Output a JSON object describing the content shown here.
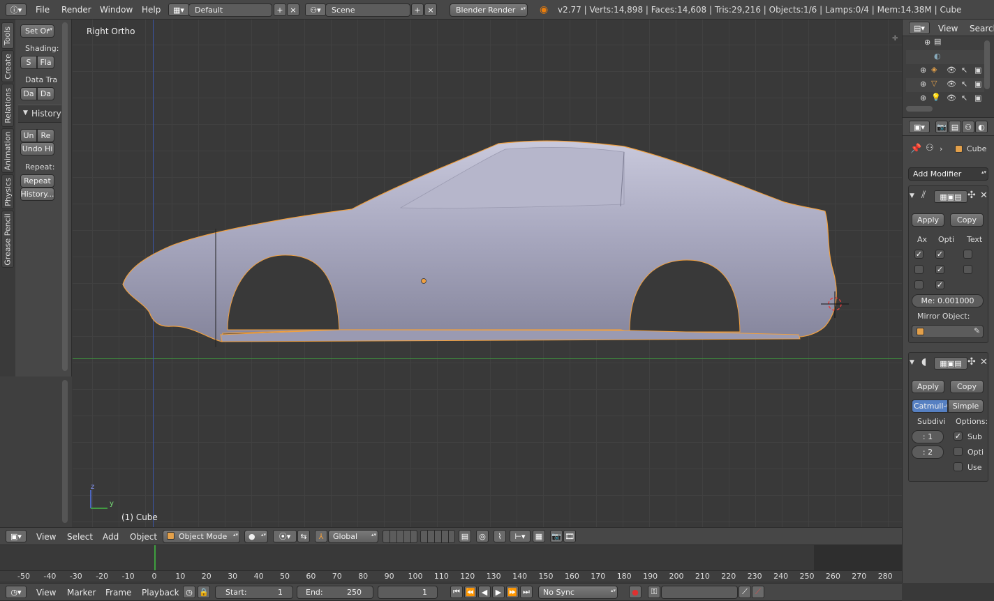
{
  "top_bar": {
    "menus": [
      "File",
      "Render",
      "Window",
      "Help"
    ],
    "layout": "Default",
    "scene": "Scene",
    "engine": "Blender Render",
    "stats": "v2.77 | Verts:14,898 | Faces:14,608 | Tris:29,216 | Objects:1/6 | Lamps:0/4 | Mem:14.38M | Cube"
  },
  "tool_shelf": {
    "tabs": [
      "Tools",
      "Create",
      "Relations",
      "Animation",
      "Physics",
      "Grease Pencil"
    ],
    "set_origin": "Set Or",
    "shading_label": "Shading:",
    "shading_smooth": "S",
    "shading_flat": "Fla",
    "data_transfer_label": "Data Tra",
    "data_btn1": "Da",
    "data_btn2": "Da",
    "history_header": "History",
    "undo": "Un",
    "redo": "Re",
    "undo_history": "Undo Hi",
    "repeat_label": "Repeat:",
    "repeat": "Repeat",
    "history_btn": "History..."
  },
  "viewport": {
    "view_name": "Right Ortho",
    "object_info": "(1) Cube",
    "axis_z": "z",
    "axis_y": "y"
  },
  "viewport_header": {
    "menus": [
      "View",
      "Select",
      "Add",
      "Object"
    ],
    "mode": "Object Mode",
    "orientation": "Global"
  },
  "timeline": {
    "ticks": [
      -50,
      -40,
      -30,
      -20,
      -10,
      0,
      10,
      20,
      30,
      40,
      50,
      60,
      70,
      80,
      90,
      100,
      110,
      120,
      130,
      140,
      150,
      160,
      170,
      180,
      190,
      200,
      210,
      220,
      230,
      240,
      250,
      260,
      270,
      280
    ],
    "menus": [
      "View",
      "Marker",
      "Frame",
      "Playback"
    ],
    "start_label": "Start:",
    "start_value": "1",
    "end_label": "End:",
    "end_value": "250",
    "current_frame": "1",
    "sync": "No Sync"
  },
  "outliner": {
    "view_menu": "View",
    "search_menu": "Search"
  },
  "properties": {
    "breadcrumb_object": "Cube",
    "add_modifier": "Add Modifier",
    "mirror": {
      "apply": "Apply",
      "copy": "Copy",
      "col_axis": "Ax",
      "col_options": "Opti",
      "col_textures": "Text",
      "merge_field": "Me: 0.001000",
      "mirror_object_label": "Mirror Object:"
    },
    "subsurf": {
      "apply": "Apply",
      "copy": "Copy",
      "catmull": "Catmull-C",
      "simple": "Simple",
      "subdiv_label": "Subdivi",
      "options_label": "Options:",
      "view_levels": "1",
      "render_levels": "2",
      "opt_sub": "Sub",
      "opt_opti": "Opti",
      "opt_use": "Use"
    }
  }
}
